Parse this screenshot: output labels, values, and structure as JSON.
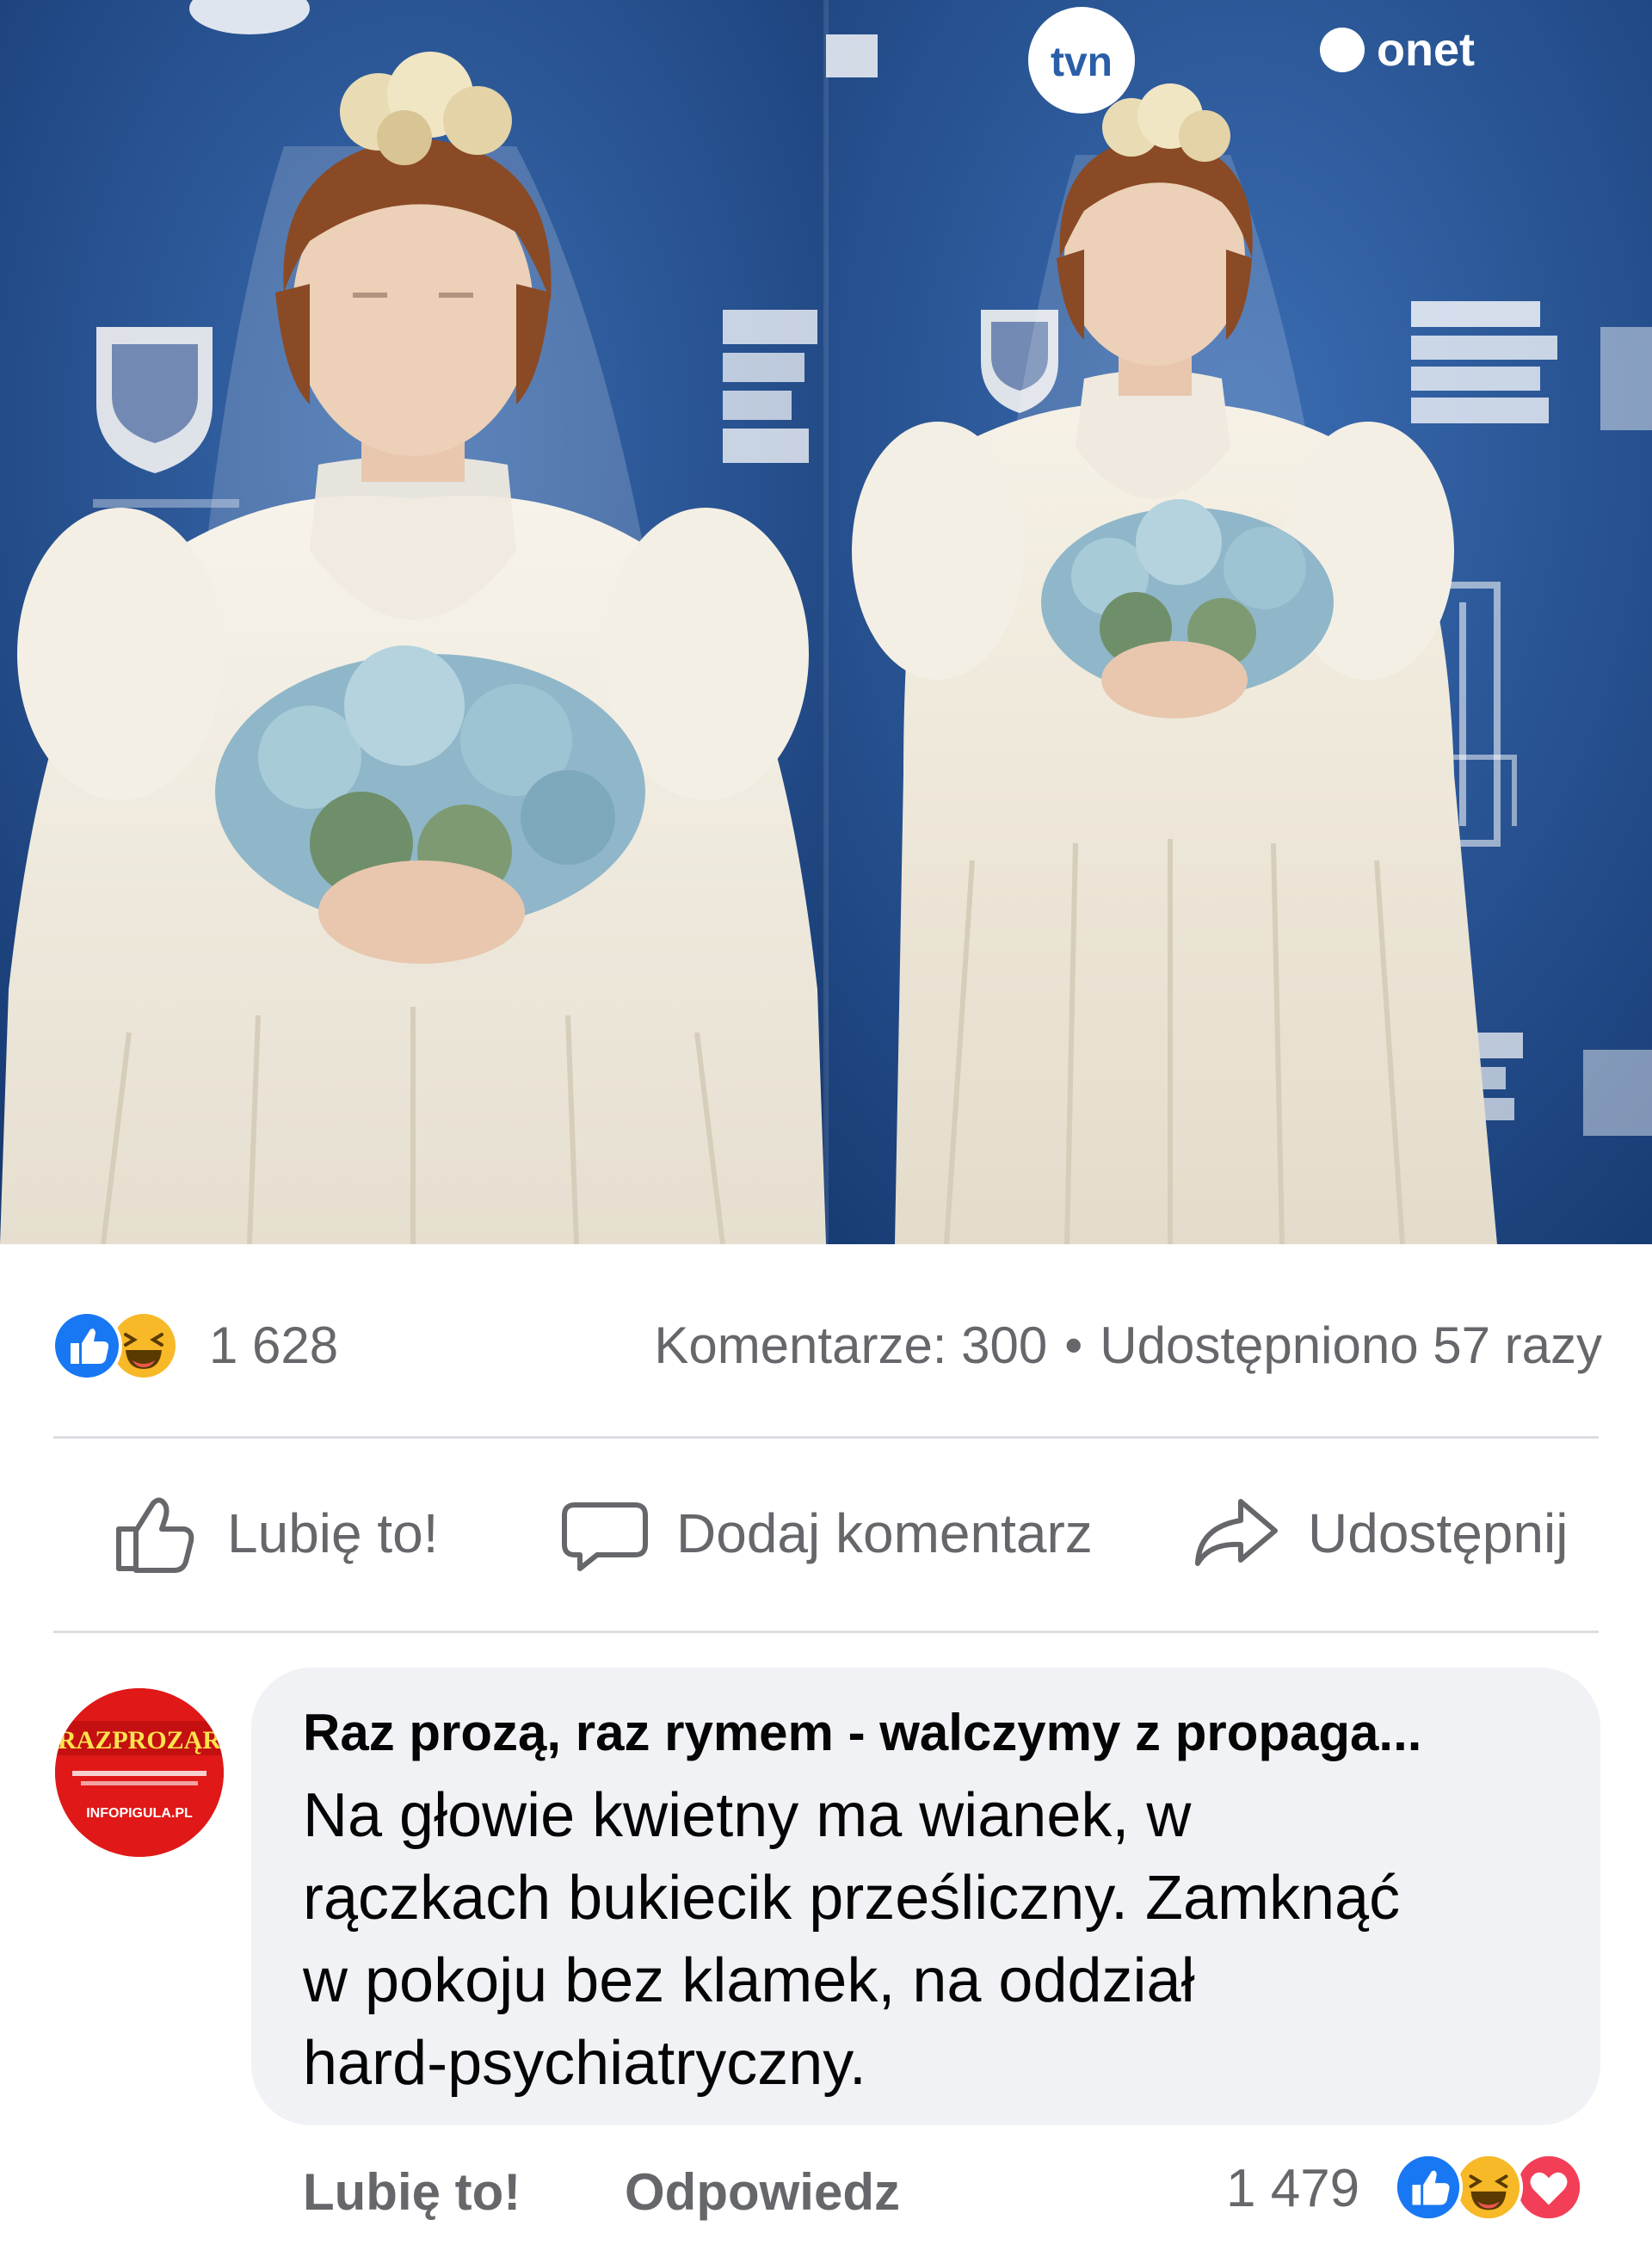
{
  "post": {
    "reactions": {
      "count": "1 628",
      "icons": [
        "like-icon",
        "haha-icon"
      ]
    },
    "comments_label": "Komentarze: 300",
    "separator": "•",
    "shares_label": "Udostępniono 57 razy"
  },
  "actions": {
    "like_label": "Lubię to!",
    "comment_label": "Dodaj komentarz",
    "share_label": "Udostępnij"
  },
  "photo": {
    "backdrop_logos": [
      "tvn",
      "onet"
    ]
  },
  "comment": {
    "author": "Raz prozą, raz rymem - walczymy z propaga...",
    "avatar_text_top": "RAZPROZĄR",
    "avatar_text_bottom": "INFOPIGULA.PL",
    "text_lines": [
      "Na głowie kwietny ma wianek, w",
      "rączkach bukiecik prześliczny. Zamknąć",
      "w pokoju bez klamek, na oddział",
      "hard-psychiatryczny."
    ],
    "like_link": "Lubię to!",
    "reply_link": "Odpowiedz",
    "reaction_count": "1 479",
    "reaction_icons": [
      "like-icon",
      "haha-icon",
      "love-icon"
    ]
  },
  "colors": {
    "like_blue": "#1877f2",
    "haha_yellow": "#f7b928",
    "love_red": "#f33e58",
    "secondary_text": "#65676b",
    "bubble_bg": "#f0f2f5",
    "backdrop_blue": "#1f4e93"
  }
}
